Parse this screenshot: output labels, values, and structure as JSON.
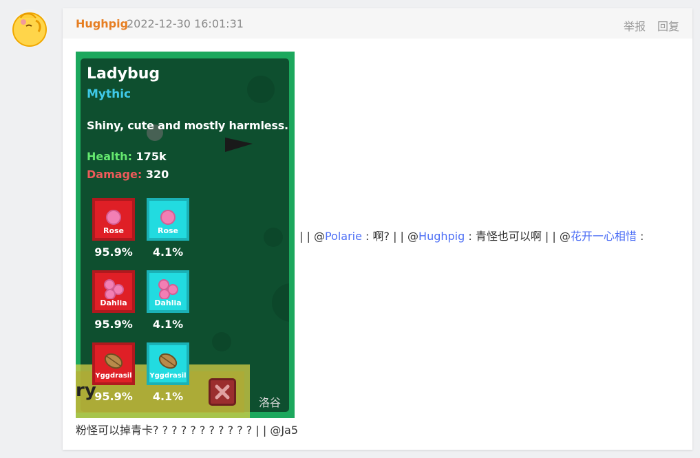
{
  "post": {
    "author": "Hughpig",
    "time": "2022-12-30 16:01:31",
    "actions": {
      "report": "举报",
      "reply": "回复"
    }
  },
  "game_card": {
    "name": "Ladybug",
    "rarity": "Mythic",
    "description": "Shiny, cute and mostly harmless.",
    "health_label": "Health:",
    "health_value": "175k",
    "damage_label": "Damage:",
    "damage_value": "320",
    "drops": [
      {
        "name": "Rose",
        "rate": "95.9%",
        "color": "red"
      },
      {
        "name": "Rose",
        "rate": "4.1%",
        "color": "cyan"
      },
      {
        "name": "Dahlia",
        "rate": "95.9%",
        "color": "red"
      },
      {
        "name": "Dahlia",
        "rate": "4.1%",
        "color": "cyan"
      },
      {
        "name": "Yggdrasil",
        "rate": "95.9%",
        "color": "red"
      },
      {
        "name": "Yggdrasil",
        "rate": "4.1%",
        "color": "cyan"
      }
    ],
    "partial_text": "ry",
    "watermark": "洛谷"
  },
  "content": {
    "sep1": "| | @",
    "mention1": "Polarie",
    "text1": " : 啊?    | | @",
    "mention2": "Hughpig",
    "text2": " : 青怪也可以啊 | | @",
    "mention3": "花开一心相惜",
    "text3": " :",
    "line2": "粉怪可以掉青卡? ? ? ? ? ? ? ? ? ? ?  | | @Ja5"
  },
  "colors": {
    "author": "#e67e22",
    "mention": "#4c6ef5",
    "rarity_mythic": "#3fc9e8",
    "health": "#65e86f",
    "damage": "#ee5a5a"
  }
}
